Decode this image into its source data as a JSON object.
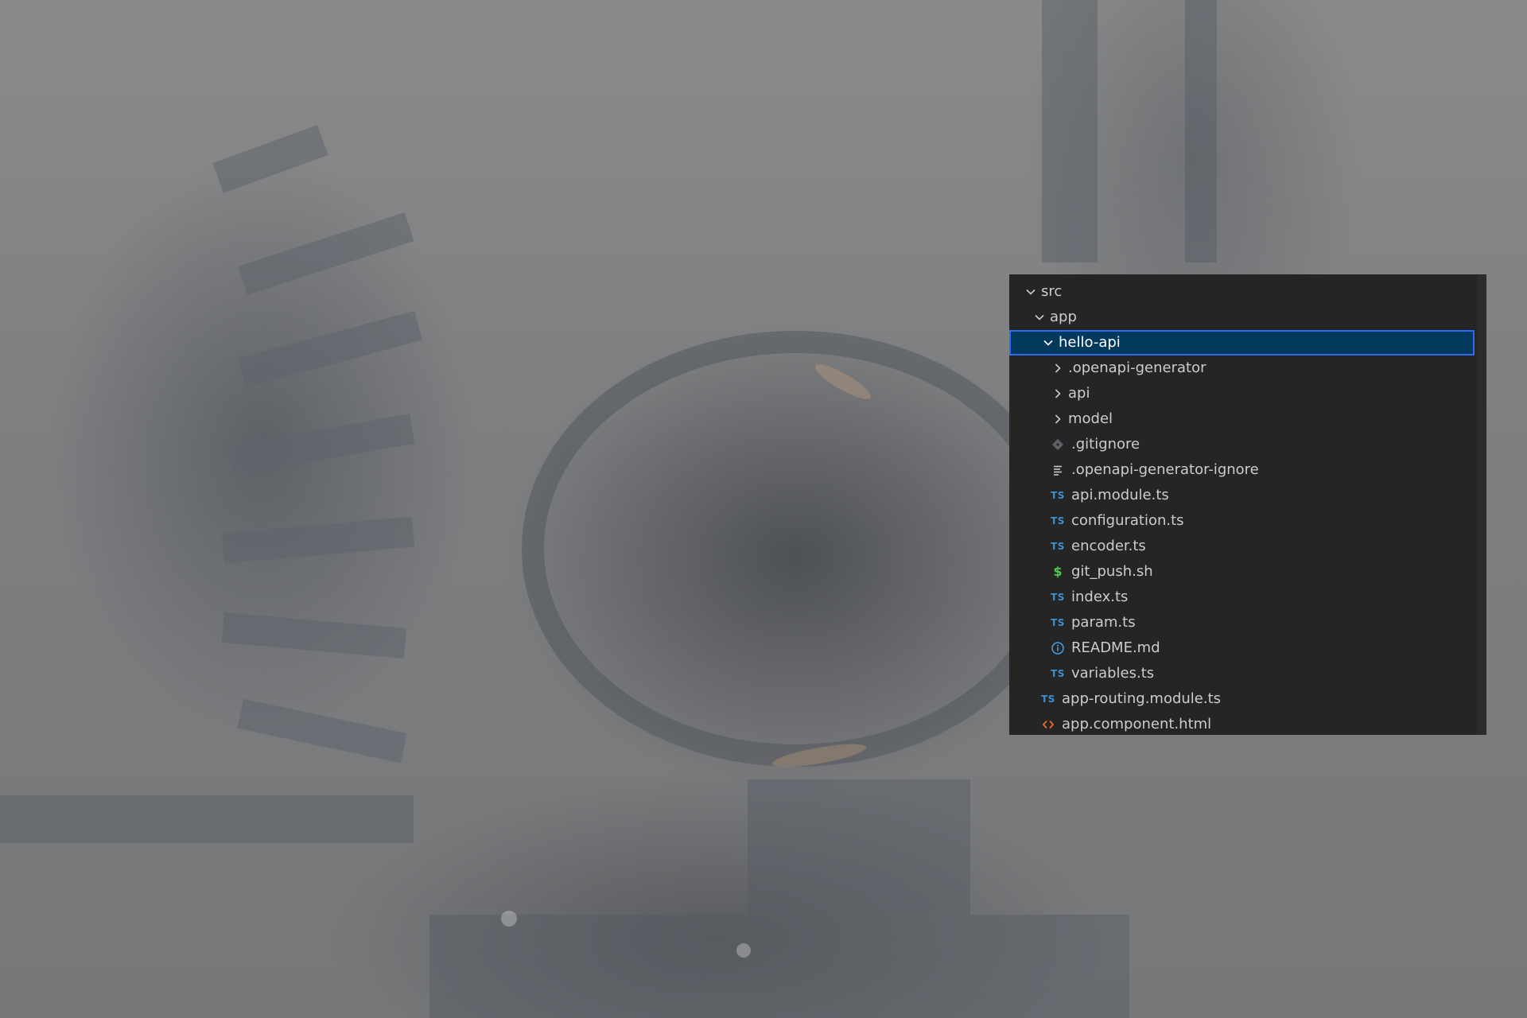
{
  "colors": {
    "panel_bg": "#252526",
    "selection_bg": "#04395e",
    "selection_border": "#2f6cf5",
    "text": "#cccccc",
    "ts_icon": "#3d8fd1",
    "shell_icon": "#4ec94b",
    "html_icon": "#e8692c"
  },
  "tree": {
    "src": {
      "label": "src",
      "icon": "chevron-down-icon"
    },
    "app": {
      "label": "app",
      "icon": "chevron-down-icon"
    },
    "hello_api": {
      "label": "hello-api",
      "icon": "chevron-down-icon"
    },
    "items": [
      {
        "label": ".openapi-generator",
        "icon": "chevron-right-icon"
      },
      {
        "label": "api",
        "icon": "chevron-right-icon"
      },
      {
        "label": "model",
        "icon": "chevron-right-icon"
      },
      {
        "label": ".gitignore",
        "icon": "git-icon"
      },
      {
        "label": ".openapi-generator-ignore",
        "icon": "lines-file-icon"
      },
      {
        "label": "api.module.ts",
        "icon": "typescript-icon",
        "badge": "TS"
      },
      {
        "label": "configuration.ts",
        "icon": "typescript-icon",
        "badge": "TS"
      },
      {
        "label": "encoder.ts",
        "icon": "typescript-icon",
        "badge": "TS"
      },
      {
        "label": "git_push.sh",
        "icon": "shell-icon",
        "badge": "$"
      },
      {
        "label": "index.ts",
        "icon": "typescript-icon",
        "badge": "TS"
      },
      {
        "label": "param.ts",
        "icon": "typescript-icon",
        "badge": "TS"
      },
      {
        "label": "README.md",
        "icon": "info-icon"
      },
      {
        "label": "variables.ts",
        "icon": "typescript-icon",
        "badge": "TS"
      }
    ],
    "app_files": [
      {
        "label": "app-routing.module.ts",
        "icon": "typescript-icon",
        "badge": "TS"
      },
      {
        "label": "app.component.html",
        "icon": "html-icon"
      }
    ]
  }
}
